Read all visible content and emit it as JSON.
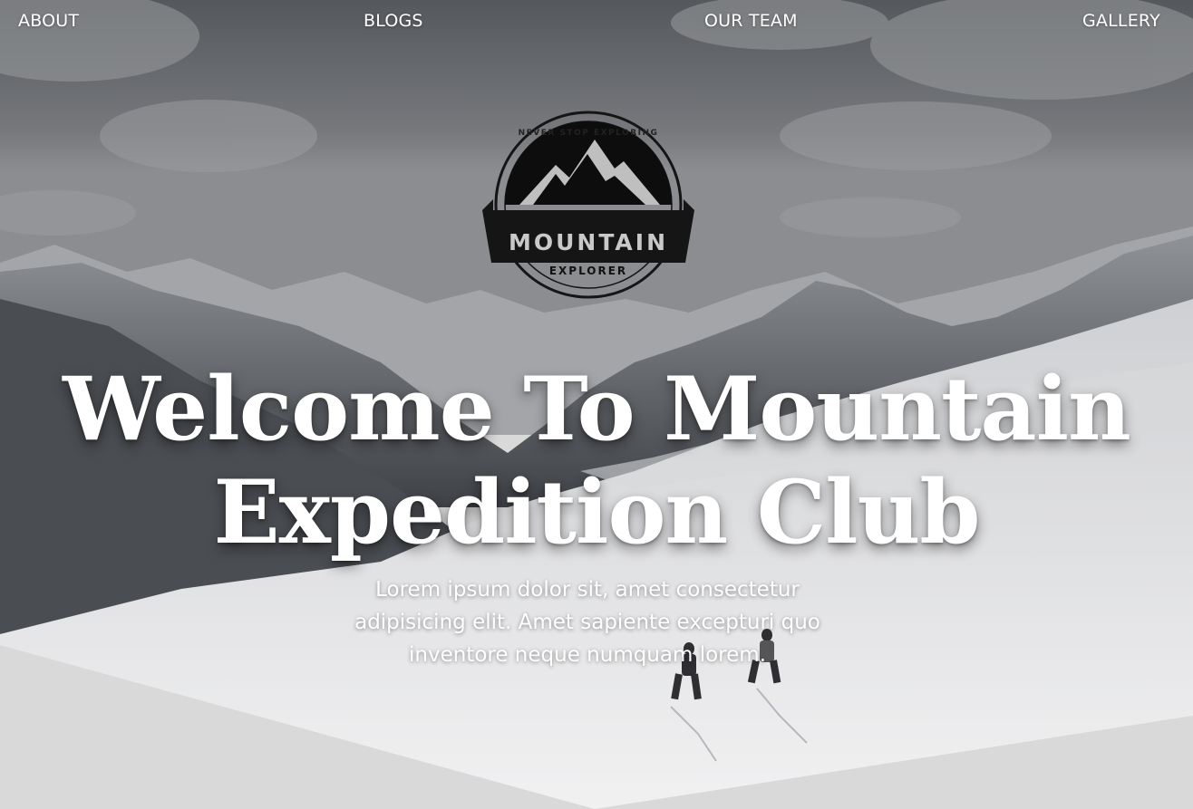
{
  "nav": {
    "items": [
      {
        "label": "ABOUT"
      },
      {
        "label": "BLOGS"
      },
      {
        "label": "OUR TEAM"
      },
      {
        "label": "GALLERY"
      }
    ]
  },
  "logo": {
    "tagline": "NEVER STOP EXPLORING",
    "name": "MOUNTAIN",
    "subtitle": "EXPLORER"
  },
  "hero": {
    "headline_line1": "Welcome To Mountain",
    "headline_line2": "Expedition Club",
    "lede": "Lorem ipsum dolor sit, amet consectetur adipisicing elit. Amet sapiente excepturi quo inventore neque numquam lorem."
  },
  "colors": {
    "text": "#ffffff",
    "bottom_panel": "#d9d9d9",
    "sky": "#5c5f63",
    "snow": "#e8e8ea"
  }
}
